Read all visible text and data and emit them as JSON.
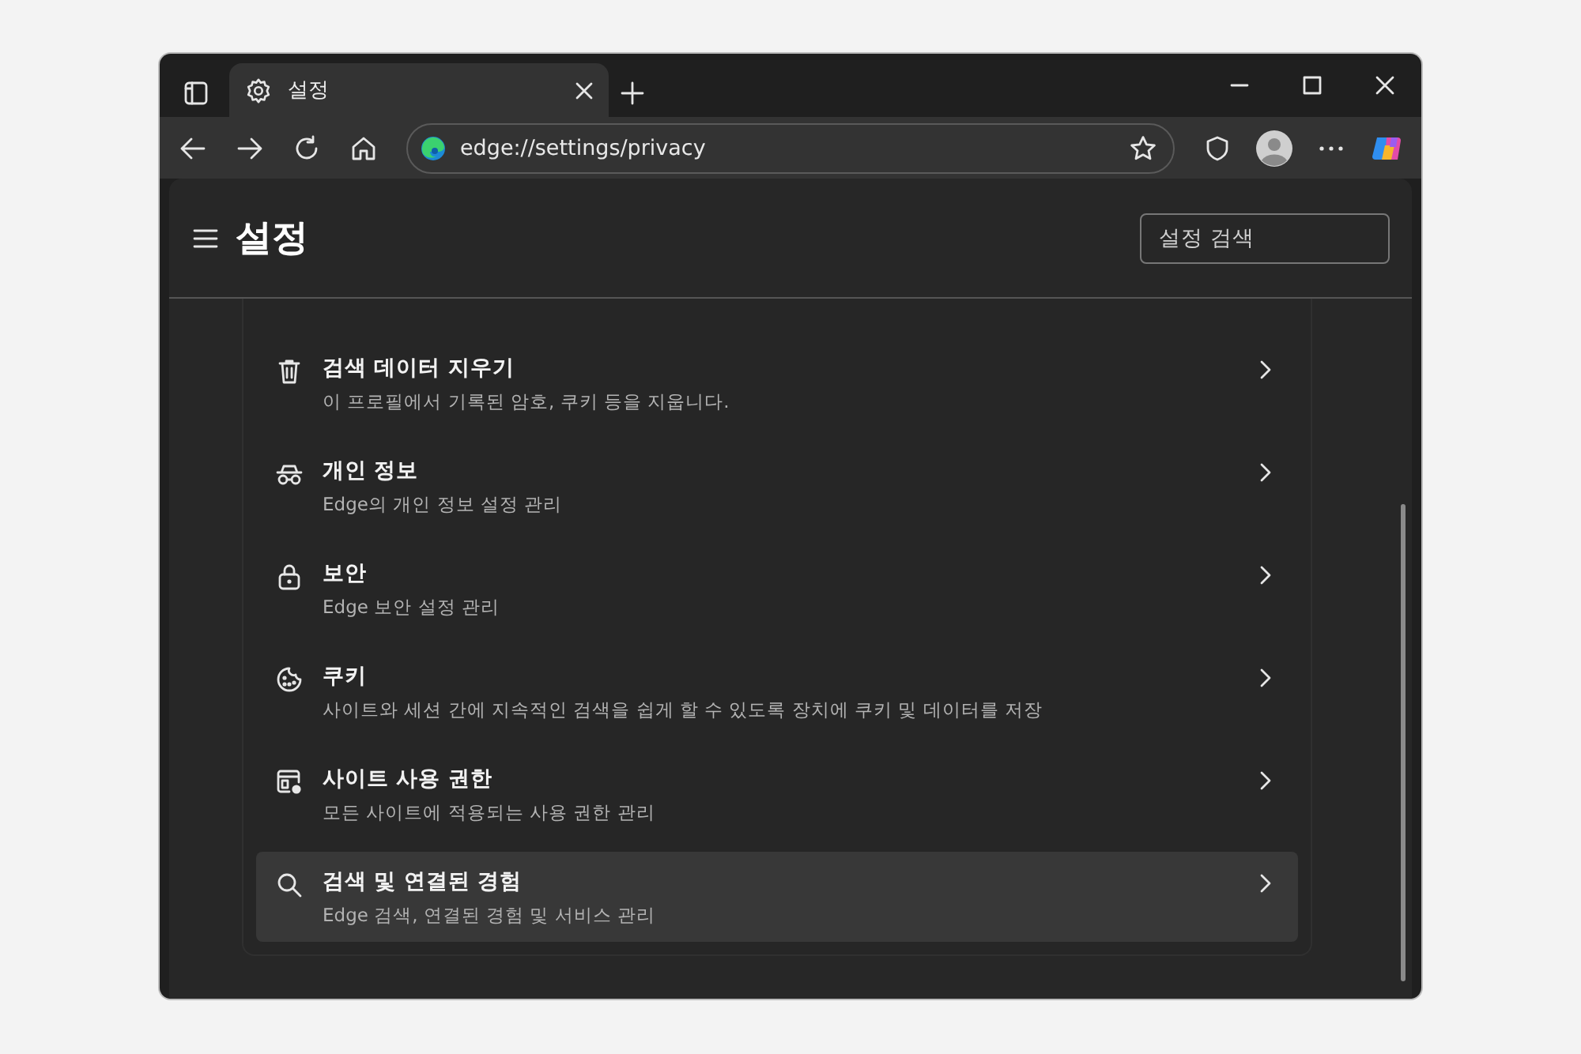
{
  "window": {
    "tabs": [
      {
        "title": "설정",
        "selected": true
      }
    ],
    "address": "edge://settings/privacy"
  },
  "header": {
    "title": "설정",
    "search": {
      "placeholder": "설정 검색"
    }
  },
  "items": [
    {
      "title": "검색 데이터 지우기",
      "description": "이 프로필에서 기록된 암호, 쿠키 등을 지웁니다.",
      "selected": false
    },
    {
      "title": "개인 정보",
      "description": "Edge의 개인 정보 설정 관리",
      "selected": false
    },
    {
      "title": "보안",
      "description": "Edge 보안 설정 관리",
      "selected": false
    },
    {
      "title": "쿠키",
      "description": "사이트와 세션 간에 지속적인 검색을 쉽게 할 수 있도록 장치에 쿠키 및 데이터를 저장",
      "selected": false
    },
    {
      "title": "사이트 사용 권한",
      "description": "모든 사이트에 적용되는 사용 권한 관리",
      "selected": false
    },
    {
      "title": "검색 및 연결된 경험",
      "description": "Edge 검색, 연결된 경험 및 서비스 관리",
      "selected": true
    }
  ]
}
